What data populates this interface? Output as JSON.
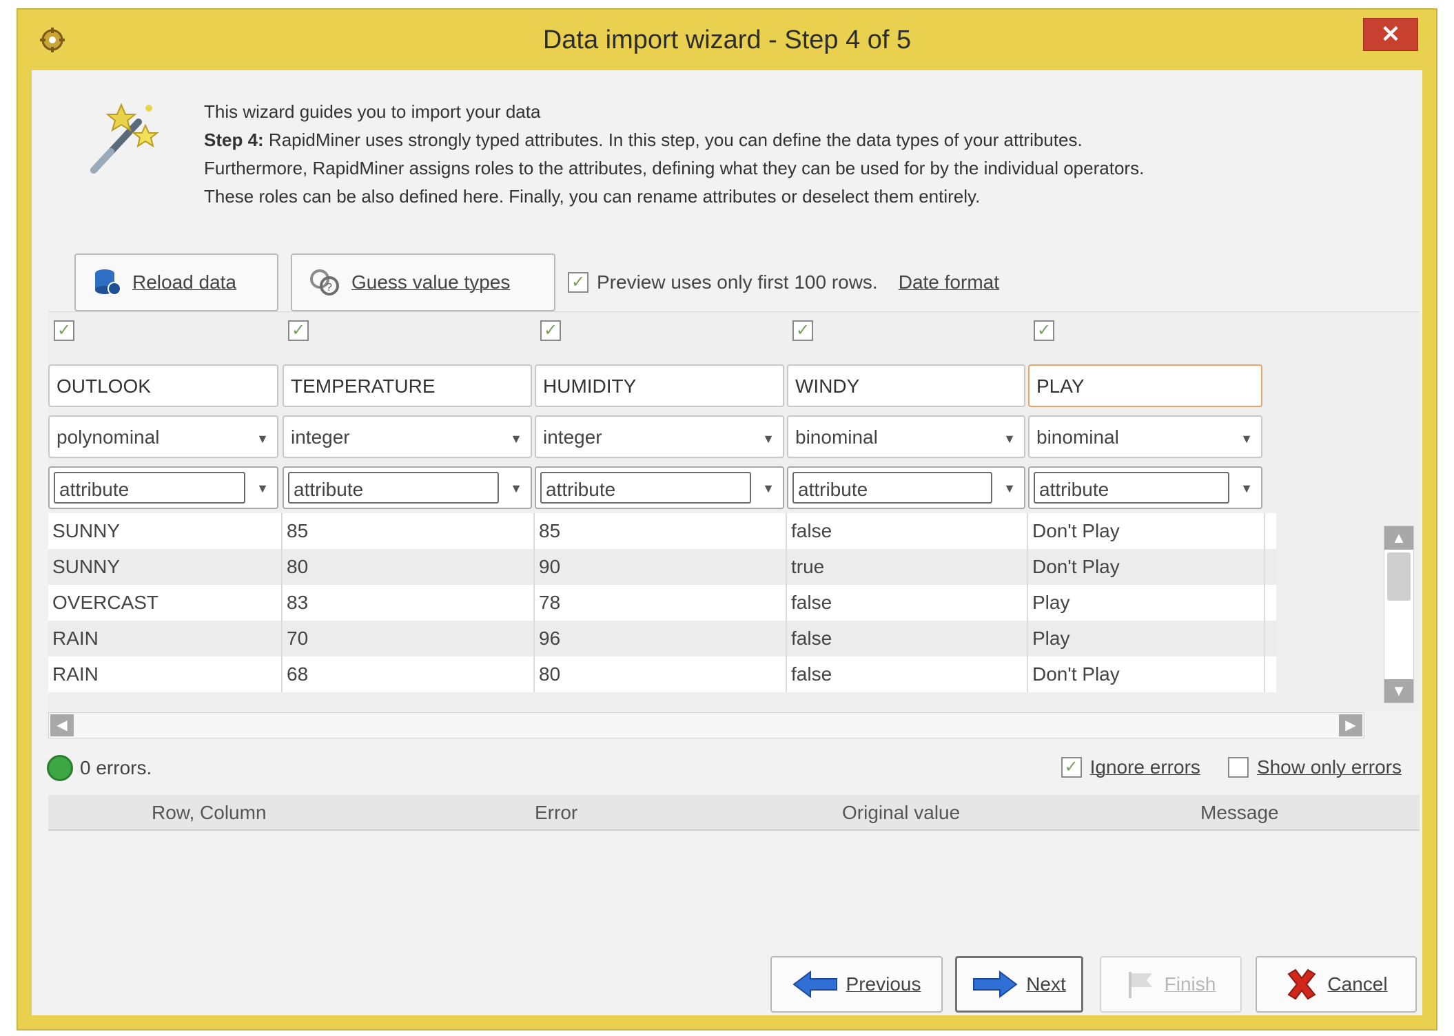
{
  "window": {
    "title": "Data import wizard - Step 4 of 5",
    "close_label": "✕"
  },
  "intro": {
    "line1": "This wizard guides you to import your data",
    "step_label": "Step 4:",
    "line2": " RapidMiner uses strongly typed attributes. In this step, you can define the data types of your attributes.",
    "line3": "Furthermore, RapidMiner assigns roles to the attributes, defining what they can be used for by the individual operators.",
    "line4": "These roles can be also defined here. Finally, you can rename attributes or deselect them entirely."
  },
  "toolbar": {
    "reload_label": "Reload data",
    "guess_label": "Guess value types",
    "preview_label": "Preview uses only first 100 rows.",
    "date_format_label": "Date format",
    "preview_checked": true
  },
  "columns": [
    {
      "name": "OUTLOOK",
      "type": "polynominal",
      "role": "attribute"
    },
    {
      "name": "TEMPERATURE",
      "type": "integer",
      "role": "attribute"
    },
    {
      "name": "HUMIDITY",
      "type": "integer",
      "role": "attribute"
    },
    {
      "name": "WINDY",
      "type": "binominal",
      "role": "attribute"
    },
    {
      "name": "PLAY",
      "type": "binominal",
      "role": "attribute"
    }
  ],
  "rows": [
    [
      "SUNNY",
      "85",
      "85",
      "false",
      "Don't Play"
    ],
    [
      "SUNNY",
      "80",
      "90",
      "true",
      "Don't Play"
    ],
    [
      "OVERCAST",
      "83",
      "78",
      "false",
      "Play"
    ],
    [
      "RAIN",
      "70",
      "96",
      "false",
      "Play"
    ],
    [
      "RAIN",
      "68",
      "80",
      "false",
      "Don't Play"
    ]
  ],
  "errors": {
    "status_text": "0 errors.",
    "ignore_label": "Ignore errors",
    "ignore_checked": true,
    "show_only_label": "Show only errors",
    "show_only_checked": false,
    "headers": [
      "Row, Column",
      "Error",
      "Original value",
      "Message"
    ]
  },
  "buttons": {
    "previous_label": "Previous",
    "next_label": "Next",
    "finish_label": "Finish",
    "cancel_label": "Cancel"
  },
  "colors": {
    "title_bar": "#e9d14f",
    "close_button": "#c8402f",
    "ok_status": "#3ca743",
    "arrow_blue": "#2f6fd6",
    "cancel_red": "#d0261c"
  }
}
